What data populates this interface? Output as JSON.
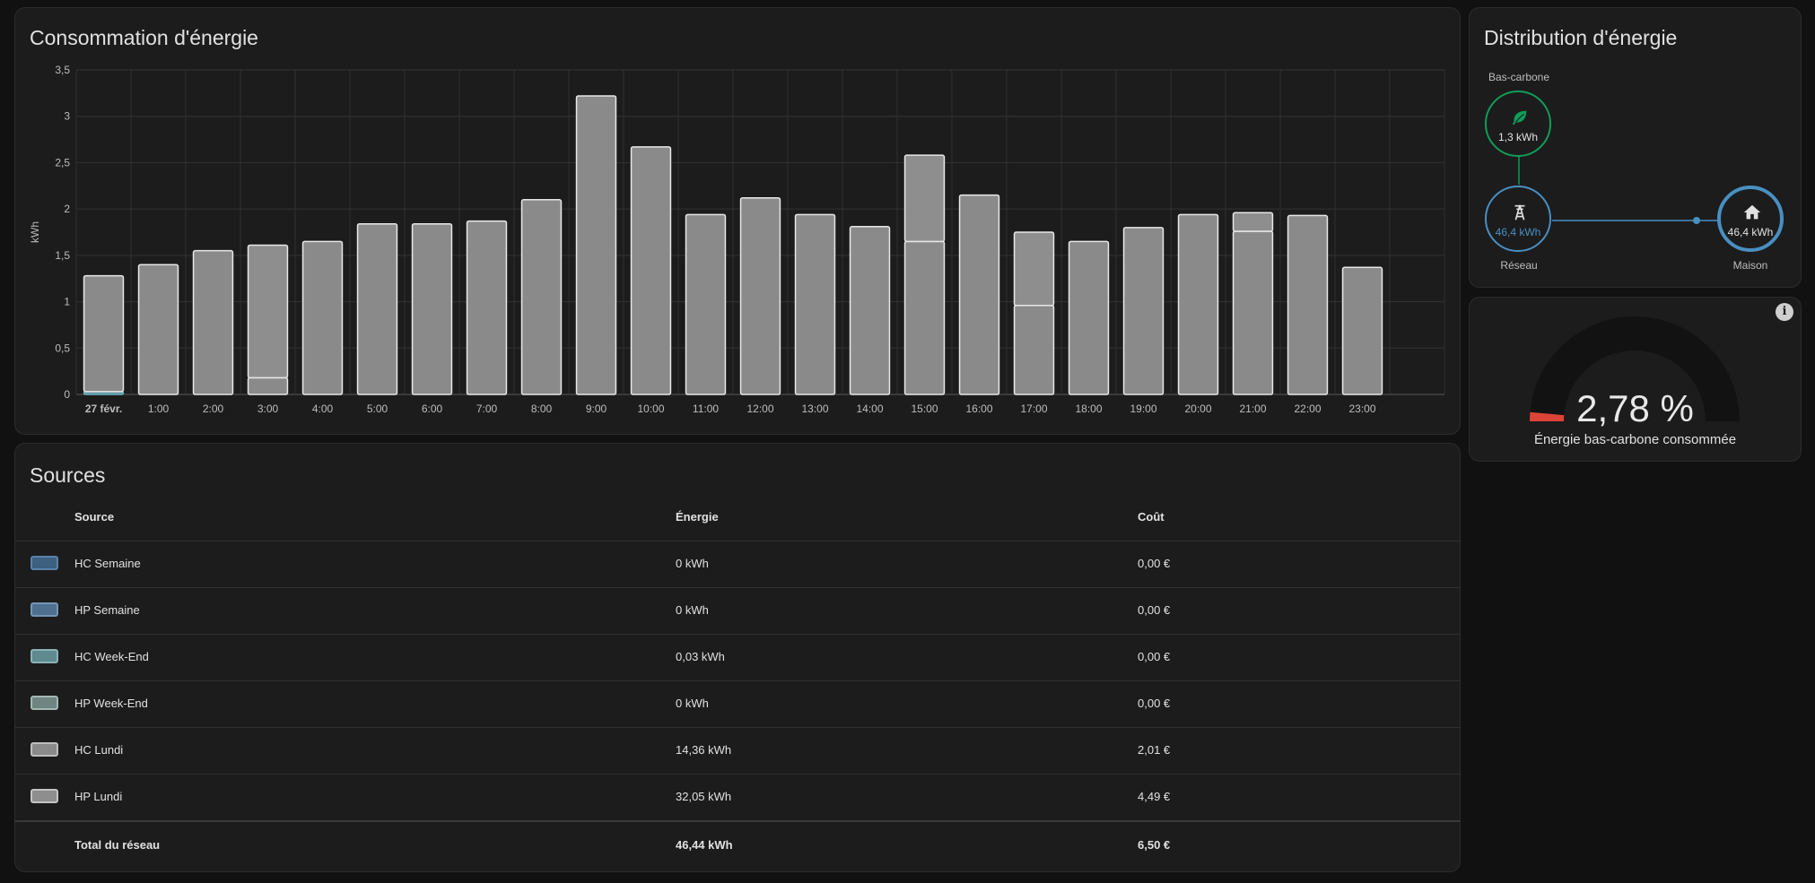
{
  "energy_card": {
    "title": "Consommation d'énergie"
  },
  "chart_data": {
    "type": "bar",
    "stacked": true,
    "categories": [
      "27 févr.",
      "1:00",
      "2:00",
      "3:00",
      "4:00",
      "5:00",
      "6:00",
      "7:00",
      "8:00",
      "9:00",
      "10:00",
      "11:00",
      "12:00",
      "13:00",
      "14:00",
      "15:00",
      "16:00",
      "17:00",
      "18:00",
      "19:00",
      "20:00",
      "21:00",
      "22:00",
      "23:00"
    ],
    "series": [
      {
        "name": "HC Week-End",
        "color": "#5a8f9c",
        "values": [
          0.03,
          0,
          0,
          0,
          0,
          0,
          0,
          0,
          0,
          0,
          0,
          0,
          0,
          0,
          0,
          0,
          0,
          0,
          0,
          0,
          0,
          0,
          0,
          0
        ]
      },
      {
        "name": "HC Lundi",
        "color": "#8a8a8a",
        "values": [
          1.25,
          1.4,
          1.55,
          0.18,
          1.65,
          1.84,
          1.84,
          1.87,
          2.1,
          3.22,
          2.67,
          1.94,
          2.12,
          1.94,
          1.81,
          1.65,
          2.15,
          0.96,
          1.65,
          1.8,
          1.94,
          1.76,
          1.93,
          1.37
        ]
      },
      {
        "name": "HP Lundi",
        "color": "#8e8e8e",
        "values": [
          0,
          0,
          0,
          1.43,
          0,
          0,
          0,
          0,
          0,
          0,
          0,
          0,
          0,
          0,
          0,
          0.93,
          0,
          0.79,
          0,
          0,
          0,
          0.2,
          0,
          0
        ]
      }
    ],
    "ylabel": "kWh",
    "ylim": [
      0,
      3.5
    ],
    "yticks": [
      "0",
      "0,5",
      "1",
      "1,5",
      "2",
      "2,5",
      "3",
      "3,5"
    ],
    "grid": true
  },
  "sources": {
    "title": "Sources",
    "headers": {
      "source": "Source",
      "energy": "Énergie",
      "cost": "Coût"
    },
    "rows": [
      {
        "color": "#3d5f80",
        "border": "#5a82aa",
        "name": "HC Semaine",
        "energy": "0 kWh",
        "cost": "0,00 €"
      },
      {
        "color": "#4f6f8f",
        "border": "#7395b5",
        "name": "HP Semaine",
        "energy": "0 kWh",
        "cost": "0,00 €"
      },
      {
        "color": "#5f8a8f",
        "border": "#8ab3b8",
        "name": "HC Week-End",
        "energy": "0,03 kWh",
        "cost": "0,00 €"
      },
      {
        "color": "#6f8582",
        "border": "#a2b8b5",
        "name": "HP Week-End",
        "energy": "0 kWh",
        "cost": "0,00 €"
      },
      {
        "color": "#8a8a8a",
        "border": "#bdbdbd",
        "name": "HC Lundi",
        "energy": "14,36 kWh",
        "cost": "2,01 €"
      },
      {
        "color": "#8e8e8e",
        "border": "#c4c4c4",
        "name": "HP Lundi",
        "energy": "32,05 kWh",
        "cost": "4,49 €"
      }
    ],
    "total": {
      "name": "Total du réseau",
      "energy": "46,44 kWh",
      "cost": "6,50 €"
    }
  },
  "distribution": {
    "title": "Distribution d'énergie",
    "low_carbon": {
      "label": "Bas-carbone",
      "value": "1,3 kWh",
      "icon": "leaf-icon",
      "color": "#0f9d58"
    },
    "grid": {
      "label": "Réseau",
      "value": "46,4 kWh",
      "icon": "transmission-tower-icon",
      "color": "#488fc2"
    },
    "home": {
      "label": "Maison",
      "value": "46,4 kWh",
      "icon": "home-icon",
      "color": "#488fc2"
    }
  },
  "gauge": {
    "value": 2.78,
    "value_text": "2,78 %",
    "label": "Énergie bas-carbone consommée",
    "info_icon": "info-icon",
    "fill_color": "#db4437"
  }
}
